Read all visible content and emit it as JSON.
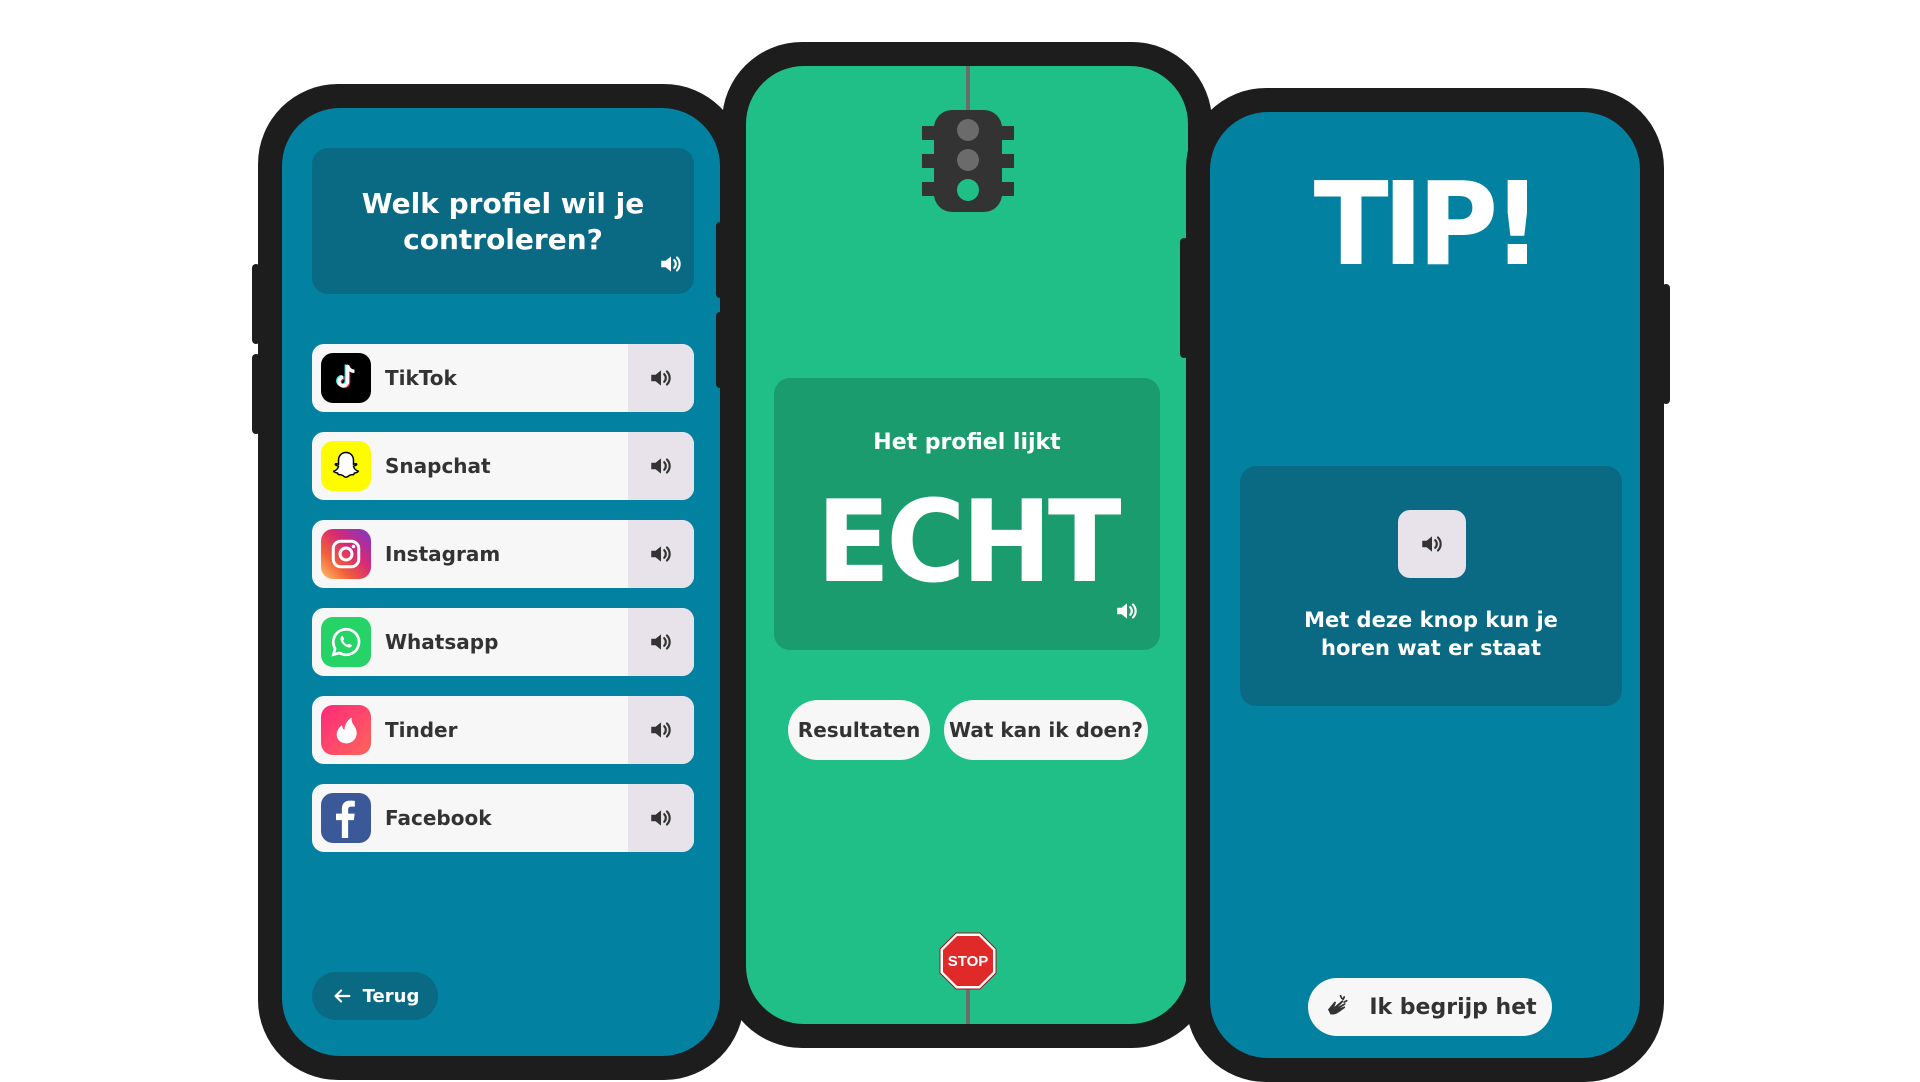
{
  "phone1": {
    "question": "Welk profiel wil je controleren?",
    "items": [
      {
        "label": "TikTok",
        "icon": "tiktok-icon"
      },
      {
        "label": "Snapchat",
        "icon": "snapchat-icon"
      },
      {
        "label": "Instagram",
        "icon": "instagram-icon"
      },
      {
        "label": "Whatsapp",
        "icon": "whatsapp-icon"
      },
      {
        "label": "Tinder",
        "icon": "tinder-icon"
      },
      {
        "label": "Facebook",
        "icon": "facebook-icon"
      }
    ],
    "back_label": "Terug"
  },
  "phone2": {
    "subtitle": "Het profiel lijkt",
    "verdict": "ECHT",
    "results_label": "Resultaten",
    "what_label": "Wat kan ik doen?",
    "stop_label": "STOP"
  },
  "phone3": {
    "title": "TIP!",
    "info_text": "Met deze knop kun je horen wat er staat",
    "confirm_label": "Ik begrijp het"
  },
  "colors": {
    "teal": "#0381a1",
    "teal_dark": "#0a6a83",
    "green": "#20bf87",
    "green_dark": "#1b9c6f",
    "phone_frame": "#1d1d1d"
  }
}
